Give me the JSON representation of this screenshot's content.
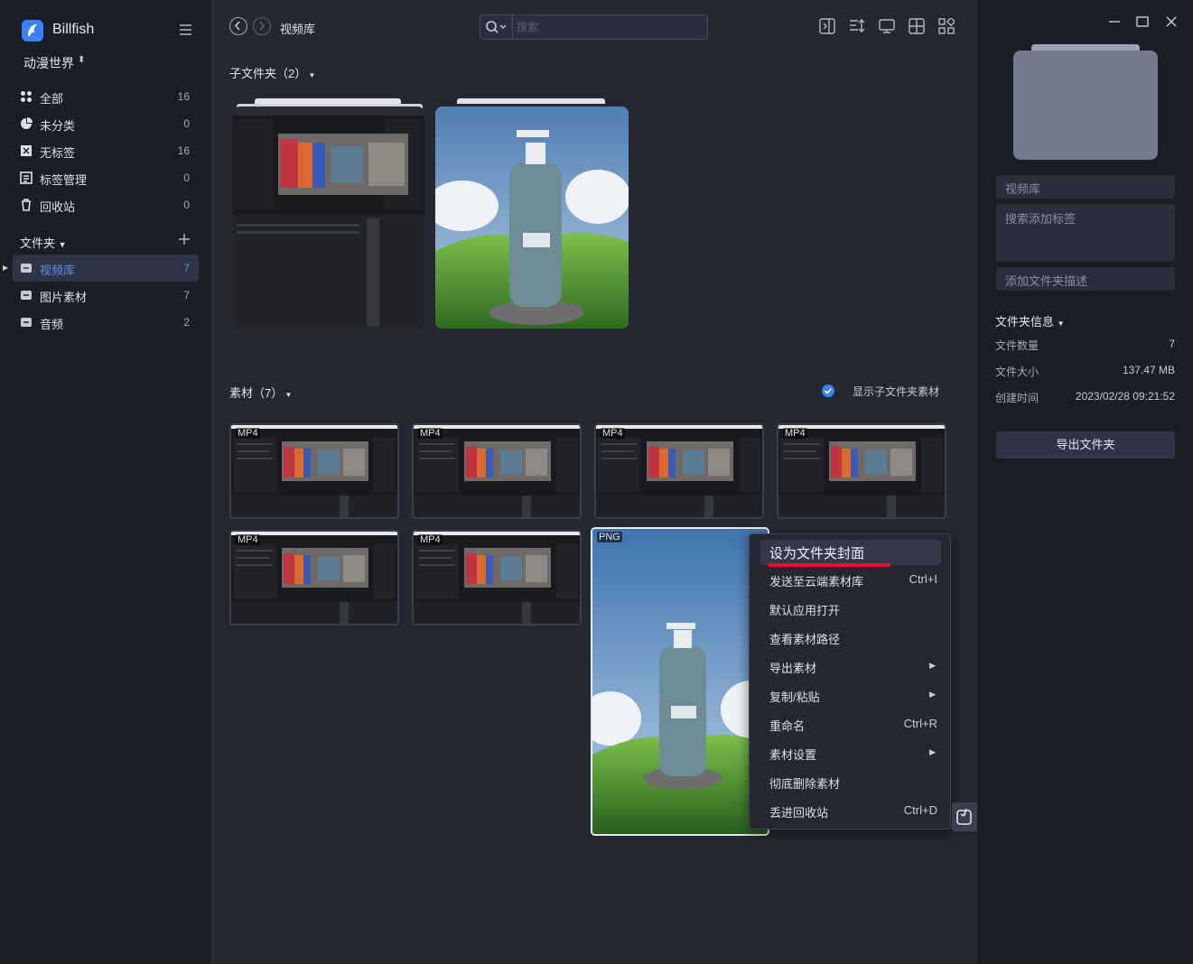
{
  "app": {
    "name": "Billfish",
    "library": "动漫世界"
  },
  "sidebar": {
    "items": [
      {
        "label": "全部",
        "count": "16"
      },
      {
        "label": "未分类",
        "count": "0"
      },
      {
        "label": "无标签",
        "count": "16"
      },
      {
        "label": "标签管理",
        "count": "0"
      },
      {
        "label": "回收站",
        "count": "0"
      }
    ],
    "folders_header": "文件夹",
    "folders": [
      {
        "label": "视频库",
        "count": "7",
        "active": true
      },
      {
        "label": "图片素材",
        "count": "7"
      },
      {
        "label": "音频",
        "count": "2"
      }
    ]
  },
  "toolbar": {
    "breadcrumb": "视频库",
    "search_placeholder": "搜索"
  },
  "subfolders": {
    "title": "子文件夹（2）"
  },
  "assets": {
    "title": "素材（7）",
    "show_subfolder_label": "显示子文件夹素材",
    "items": [
      {
        "type": "MP4"
      },
      {
        "type": "MP4"
      },
      {
        "type": "MP4"
      },
      {
        "type": "MP4"
      },
      {
        "type": "MP4"
      },
      {
        "type": "MP4"
      },
      {
        "type": "PNG"
      }
    ]
  },
  "context_menu": {
    "items": [
      {
        "label": "设为文件夹封面",
        "shortcut": ""
      },
      {
        "label": "发送至云端素材库",
        "shortcut": "Ctrl+I"
      },
      {
        "label": "默认应用打开",
        "shortcut": ""
      },
      {
        "label": "查看素材路径",
        "shortcut": ""
      },
      {
        "label": "导出素材",
        "shortcut": "",
        "submenu": true
      },
      {
        "label": "复制/粘贴",
        "shortcut": "",
        "submenu": true
      },
      {
        "label": "重命名",
        "shortcut": "Ctrl+R"
      },
      {
        "label": "素材设置",
        "shortcut": "",
        "submenu": true
      },
      {
        "label": "彻底删除素材",
        "shortcut": ""
      },
      {
        "label": "丢进回收站",
        "shortcut": "Ctrl+D"
      }
    ]
  },
  "right_panel": {
    "folder_name": "视频库",
    "tags_placeholder": "搜索添加标签",
    "desc_placeholder": "添加文件夹描述",
    "info_title": "文件夹信息",
    "info": [
      {
        "key": "文件数量",
        "value": "7"
      },
      {
        "key": "文件大小",
        "value": "137.47 MB"
      },
      {
        "key": "创建时间",
        "value": "2023/02/28 09:21:52"
      }
    ],
    "export_label": "导出文件夹"
  },
  "colors": {
    "accent": "#3b82f6",
    "highlight_underline": "#e8112d"
  }
}
